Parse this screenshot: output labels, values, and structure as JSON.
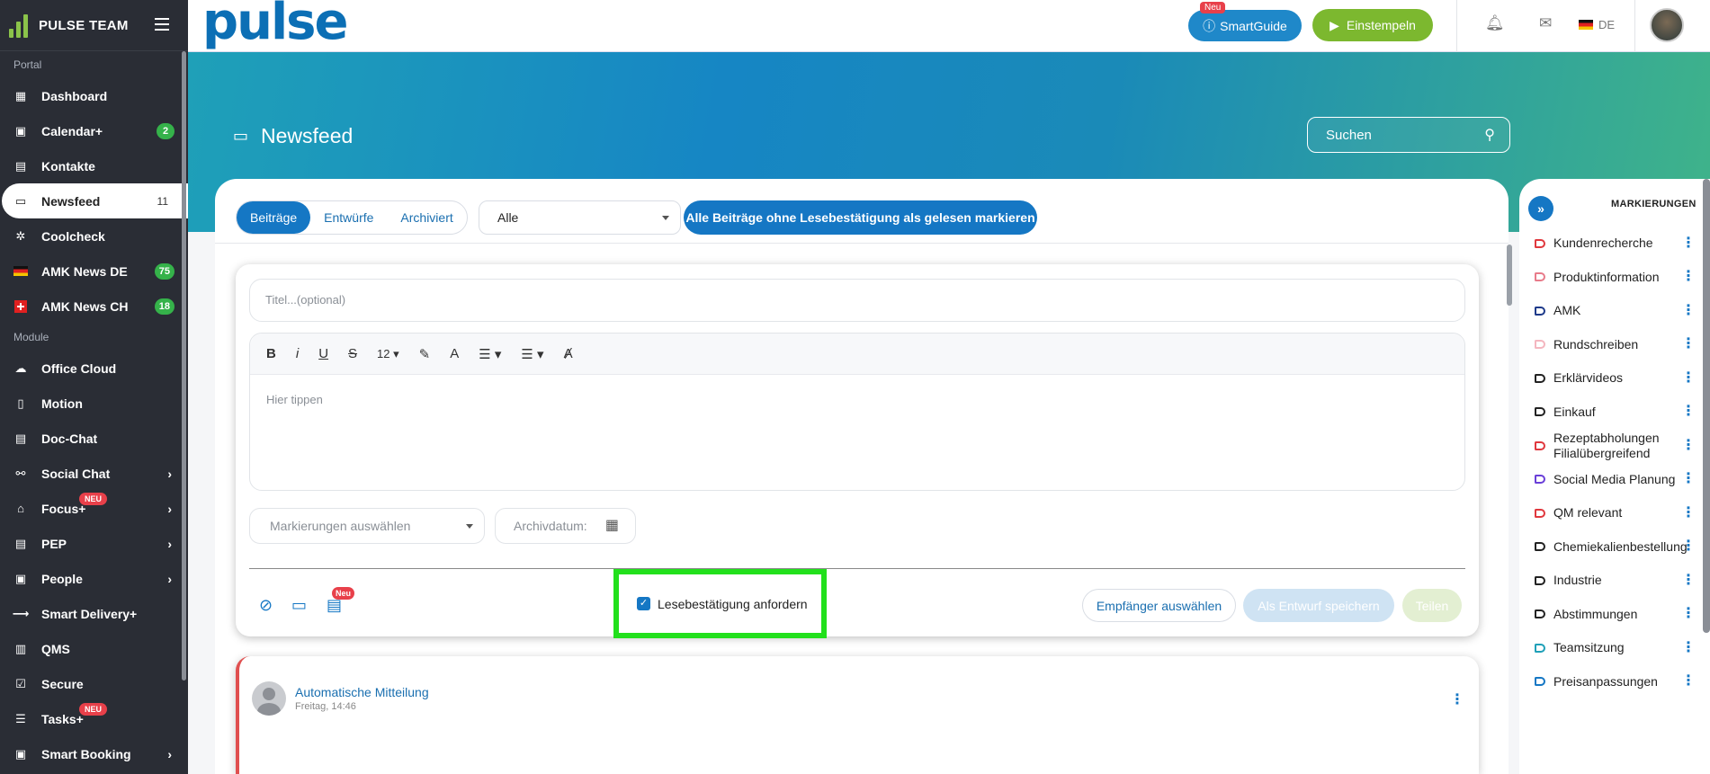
{
  "sidebar": {
    "brand": "PULSE TEAM",
    "sections": {
      "portal": "Portal",
      "module": "Module"
    },
    "items": [
      {
        "label": "Dashboard",
        "icon": "dashboard-icon"
      },
      {
        "label": "Calendar+",
        "icon": "calendar-icon",
        "badge": "2"
      },
      {
        "label": "Kontakte",
        "icon": "contacts-icon"
      },
      {
        "label": "Newsfeed",
        "icon": "newsfeed-icon",
        "count": "11"
      },
      {
        "label": "Coolcheck",
        "icon": "snowflake-icon"
      },
      {
        "label": "AMK News DE",
        "icon": "flag-de-icon",
        "badge": "75"
      },
      {
        "label": "AMK News CH",
        "icon": "flag-ch-icon",
        "badge": "18"
      },
      {
        "label": "Office Cloud",
        "icon": "cloud-icon"
      },
      {
        "label": "Motion",
        "icon": "phone-icon"
      },
      {
        "label": "Doc-Chat",
        "icon": "chat-icon"
      },
      {
        "label": "Social Chat",
        "icon": "share-icon"
      },
      {
        "label": "Focus+",
        "icon": "graduation-icon",
        "new": "NEU"
      },
      {
        "label": "PEP",
        "icon": "clipboard-icon"
      },
      {
        "label": "People",
        "icon": "people-icon"
      },
      {
        "label": "Smart Delivery+",
        "icon": "arrow-icon"
      },
      {
        "label": "QMS",
        "icon": "qms-icon"
      },
      {
        "label": "Secure",
        "icon": "secure-icon"
      },
      {
        "label": "Tasks+",
        "icon": "tasks-icon",
        "new": "NEU"
      },
      {
        "label": "Smart Booking",
        "icon": "booking-icon"
      }
    ]
  },
  "topbar": {
    "logo": "pulse",
    "smartguide": "SmartGuide",
    "smartguide_new": "Neu",
    "clock_in": "Einstempeln",
    "lang": "DE"
  },
  "banner": {
    "title": "Newsfeed",
    "search_placeholder": "Suchen"
  },
  "feed": {
    "tabs": [
      "Beiträge",
      "Entwürfe",
      "Archiviert"
    ],
    "filter": "Alle",
    "mark_all": "Alle Beiträge ohne Lesebestätigung als gelesen markieren"
  },
  "composer": {
    "title_placeholder": "Titel...(optional)",
    "font_size": "12",
    "body_placeholder": "Hier tippen",
    "tags_placeholder": "Markierungen auswählen",
    "archive_label": "Archivdatum:",
    "new_badge": "Neu",
    "read_receipt": "Lesebestätigung anfordern",
    "recipients": "Empfänger auswählen",
    "save_draft": "Als Entwurf speichern",
    "share": "Teilen"
  },
  "post": {
    "author": "Automatische Mitteilung",
    "time": "Freitag, 14:46"
  },
  "tags_panel": {
    "title": "MARKIERUNGEN",
    "items": [
      {
        "label": "Kundenrecherche",
        "color": "#e0383e"
      },
      {
        "label": "Produktinformation",
        "color": "#e87b8a"
      },
      {
        "label": "AMK",
        "color": "#1e3a8a"
      },
      {
        "label": "Rundschreiben",
        "color": "#f4b6bf"
      },
      {
        "label": "Erklärvideos",
        "color": "#222222"
      },
      {
        "label": "Einkauf",
        "color": "#222222"
      },
      {
        "label": "Rezeptabholungen Filialübergreifend",
        "color": "#e0383e"
      },
      {
        "label": "Social Media Planung",
        "color": "#6a3fd8"
      },
      {
        "label": "QM relevant",
        "color": "#e0383e"
      },
      {
        "label": "Chemiekalienbestellung",
        "color": "#222222"
      },
      {
        "label": "Industrie",
        "color": "#222222"
      },
      {
        "label": "Abstimmungen",
        "color": "#222222"
      },
      {
        "label": "Teamsitzung",
        "color": "#1fa0b8"
      },
      {
        "label": "Preisanpassungen",
        "color": "#1577c4"
      }
    ]
  }
}
